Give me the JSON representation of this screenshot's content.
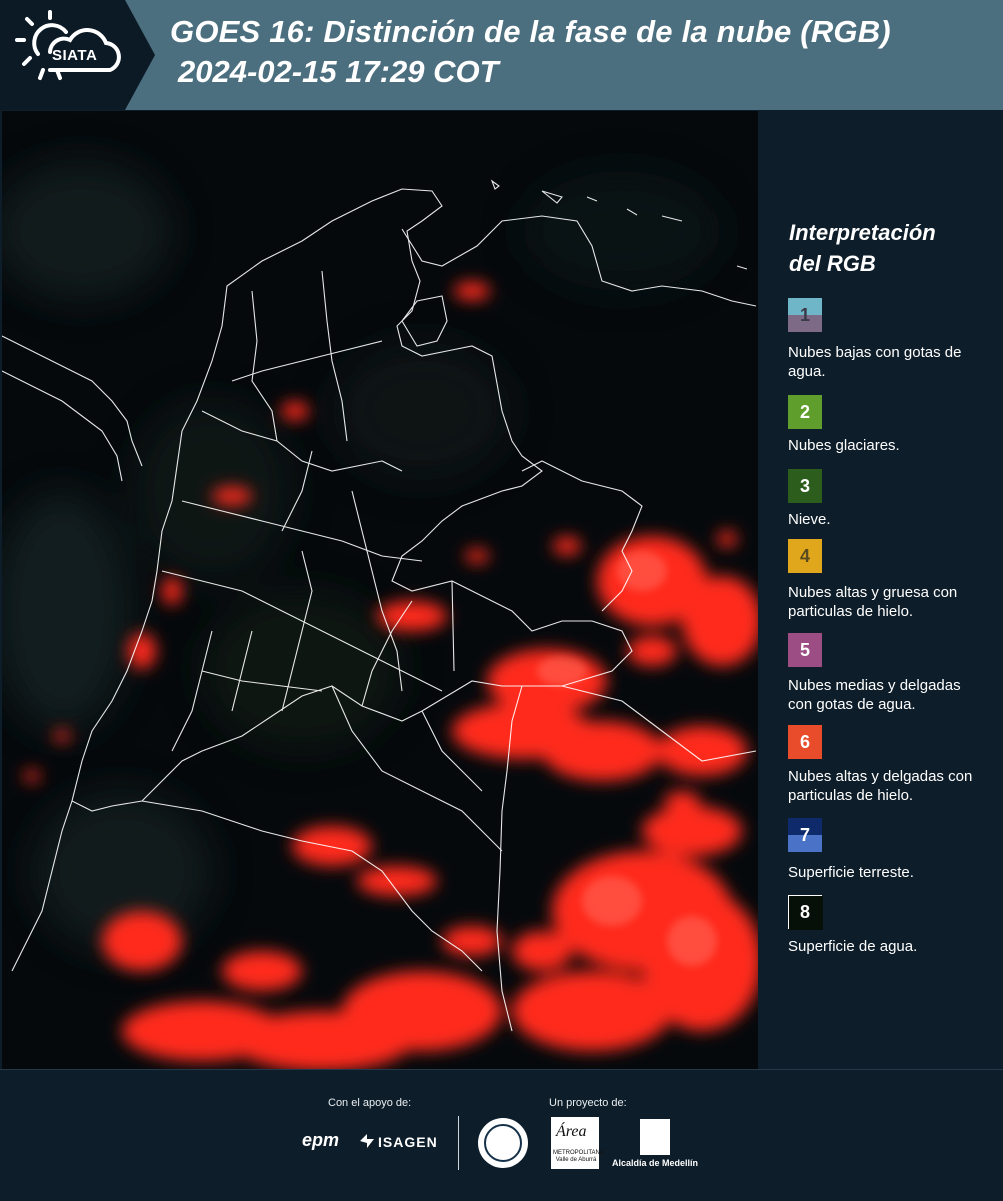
{
  "header": {
    "logo_text": "SIATA",
    "title_line1": "GOES 16: Distinción de la fase de la nube (RGB)",
    "title_line2": "2024-02-15 17:29 COT"
  },
  "map": {
    "description": "",
    "background": "#05090c",
    "boundary_color": "#ffffff",
    "cloud_color": "#ff2a1a"
  },
  "legend": {
    "title_line1": "Interpretación",
    "title_line2": "del RGB",
    "items": [
      {
        "number": "1",
        "label": "Nubes bajas con gotas de agua.",
        "color_top": "#6fb6c8",
        "color_bottom": "#7d6a87",
        "text_color": "#3a3a48"
      },
      {
        "number": "2",
        "label": "Nubes glaciares.",
        "color_top": "#5f9e2c",
        "color_bottom": "#5f9e2c",
        "text_color": "#ffffff"
      },
      {
        "number": "3",
        "label": "Nieve.",
        "color_top": "#2d5d1c",
        "color_bottom": "#2d5d1c",
        "text_color": "#ffffff"
      },
      {
        "number": "4",
        "label": "Nubes altas y gruesa con particulas de hielo.",
        "color_top": "#e0a71c",
        "color_bottom": "#e0a71c",
        "text_color": "#5a4a20"
      },
      {
        "number": "5",
        "label": "Nubes medias y delgadas con gotas de agua.",
        "color_top": "#9c4d83",
        "color_bottom": "#9c4d83",
        "text_color": "#ffffff"
      },
      {
        "number": "6",
        "label": "Nubes altas y delgadas con particulas de hielo.",
        "color_top": "#e84c2b",
        "color_bottom": "#e84c2b",
        "text_color": "#ffffff"
      },
      {
        "number": "7",
        "label": "Superficie terreste.",
        "color_top": "#0f2a6b",
        "color_bottom": "#4a72c6",
        "text_color": "#ffffff"
      },
      {
        "number": "8",
        "label": "Superficie de agua.",
        "color_top": "#071008",
        "color_bottom": "#071008",
        "text_color": "#ffffff",
        "border": "#ffffff"
      }
    ]
  },
  "footer": {
    "support_label": "Con el apoyo de:",
    "project_label": "Un proyecto de:",
    "epm": "epm",
    "isagen": "ISAGEN",
    "area_word": "Área",
    "area_sub": "METROPOLITANA Valle de Aburrá",
    "alcaldia": "Alcaldía de Medellín"
  }
}
